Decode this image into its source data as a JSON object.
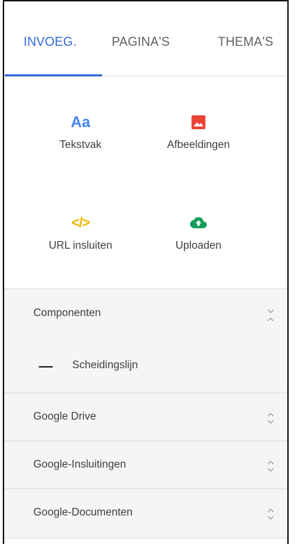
{
  "tabs": [
    {
      "label": "INVOEG.",
      "active": true
    },
    {
      "label": "PAGINA'S",
      "active": false
    },
    {
      "label": "THEMA'S",
      "active": false
    }
  ],
  "insert": {
    "tekstvak": {
      "icon_text": "Aa",
      "label": "Tekstvak",
      "icon": "text-box-icon"
    },
    "afbeeldingen": {
      "label": "Afbeeldingen",
      "icon": "image-icon"
    },
    "url": {
      "icon_text": "</>",
      "label": "URL insluiten",
      "icon": "embed-code-icon"
    },
    "uploaden": {
      "label": "Uploaden",
      "icon": "cloud-upload-icon"
    }
  },
  "sections": {
    "componenten": {
      "title": "Componenten",
      "expanded": true,
      "items": [
        {
          "label": "Scheidingslijn",
          "icon": "divider-icon"
        }
      ]
    },
    "google_drive": {
      "title": "Google Drive",
      "expanded": false
    },
    "google_insluitingen": {
      "title": "Google-Insluitingen",
      "expanded": false
    },
    "google_documenten": {
      "title": "Google-Documenten",
      "expanded": false
    }
  },
  "colors": {
    "accent": "#3367d6",
    "text_icon": "#4285f4",
    "image_icon": "#ea4335",
    "embed_icon": "#f4b400",
    "upload_icon": "#0f9d58"
  }
}
